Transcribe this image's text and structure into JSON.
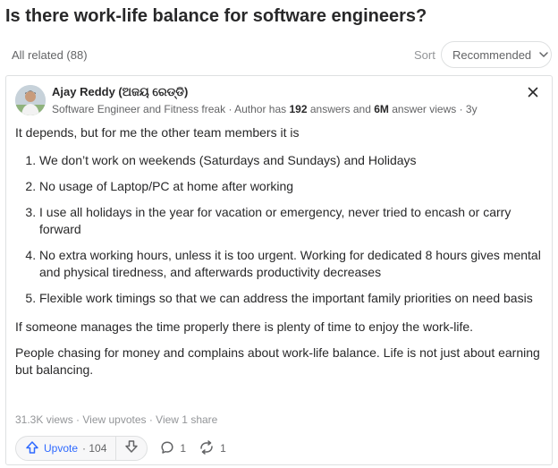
{
  "question": {
    "title": "Is there work-life balance for software engineers?"
  },
  "filters": {
    "all_related": "All related (88)",
    "sort_label": "Sort",
    "sort_value": "Recommended"
  },
  "answer": {
    "author": {
      "name": "Ajay Reddy (ଅଜୟ ରେଡ୍ଡି)",
      "credential": "Software Engineer and Fitness freak · Author has ",
      "answers_count": "192",
      "answers_text": " answers and ",
      "views_count": "6M",
      "views_text": " answer views · 3y"
    },
    "intro": "It depends, but for me the other team members it is",
    "list": [
      "We don’t work on weekends (Saturdays and Sundays) and Holidays",
      "No usage of Laptop/PC at home after working",
      "I use all holidays in the year for vacation or emergency, never tried to encash or carry forward",
      "No extra working hours, unless it is too urgent. Working for dedicated 8 hours gives mental and physical tiredness, and afterwards productivity decreases",
      "Flexible work timings so that we can address the important family priorities on need basis"
    ],
    "paragraph1": "If someone manages the time properly there is plenty of time to enjoy the work-life.",
    "paragraph2": "People chasing for money and complains about work-life balance. Life is not just about earning but balancing.",
    "stats": "31.3K views · View upvotes · View 1 share",
    "actions": {
      "upvote_label": "Upvote",
      "upvote_count": "· 104",
      "comments_count": "1",
      "shares_count": "1"
    }
  },
  "icons": {
    "close": "close-icon",
    "chevron": "chevron-down-icon",
    "upvote": "upvote-arrow-icon",
    "downvote": "downvote-arrow-icon",
    "comment": "comment-bubble-icon",
    "share": "reshare-icon"
  },
  "colors": {
    "accent": "#2e69ff",
    "text": "#282829",
    "muted": "#636466",
    "border": "#dee0e1"
  }
}
